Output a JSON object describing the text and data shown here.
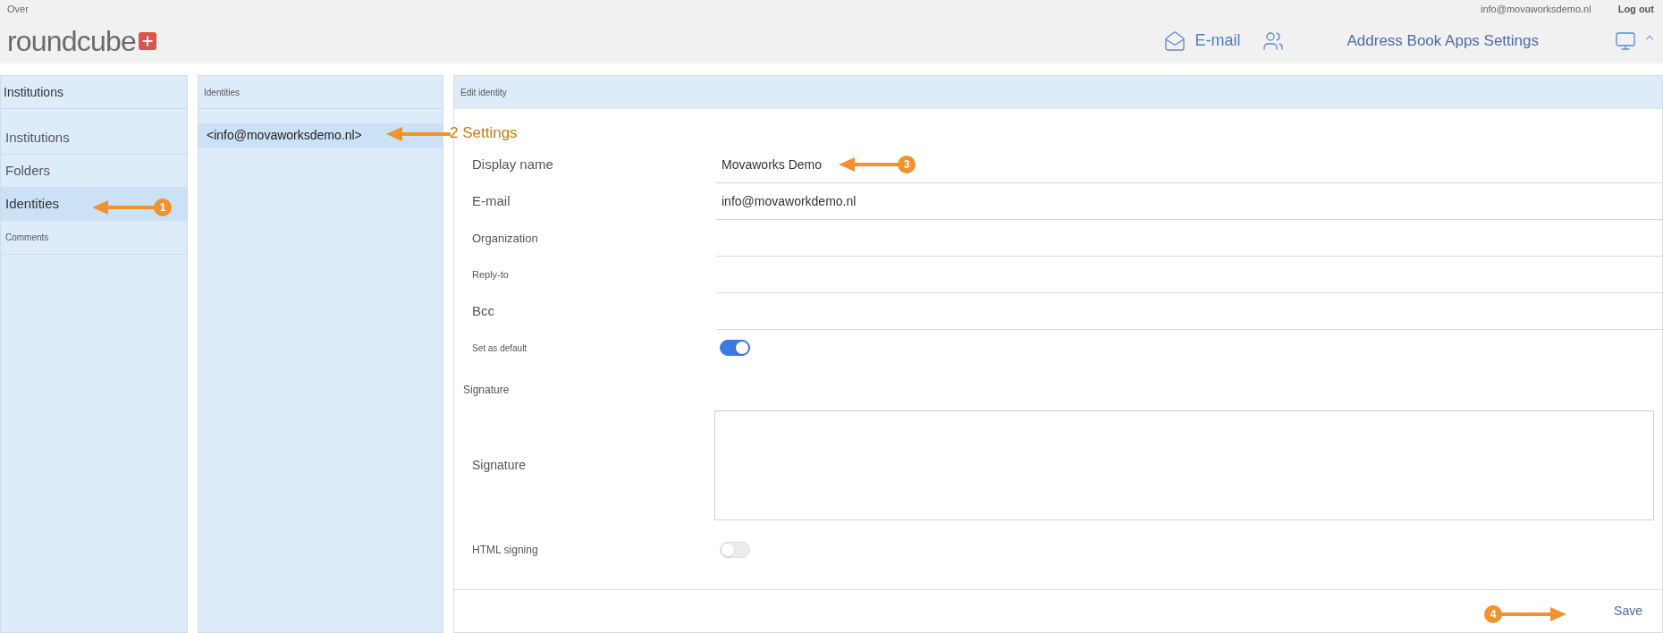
{
  "top_bar": {
    "label": "Over",
    "user_email": "info@movaworksdemo.nl",
    "logout": "Log out"
  },
  "logo": {
    "text": "roundcube"
  },
  "nav": {
    "email": "E-mail",
    "links": "Address Book Apps Settings"
  },
  "sidebar": {
    "title": "Institutions",
    "items": [
      {
        "label": "Institutions",
        "selected": false,
        "kind": "main"
      },
      {
        "label": "Folders",
        "selected": false,
        "kind": "main"
      },
      {
        "label": "Identities",
        "selected": true,
        "kind": "main"
      },
      {
        "label": "Comments",
        "selected": false,
        "kind": "minor"
      }
    ]
  },
  "identities": {
    "title": "Identities",
    "items": [
      {
        "label": "<info@movaworksdemo.nl>",
        "selected": true
      }
    ]
  },
  "form": {
    "title": "Edit identity",
    "fields": [
      {
        "kind": "text",
        "label": "Display name",
        "value": "Movaworks Demo"
      },
      {
        "kind": "text",
        "label": "E-mail",
        "value": "info@movaworkdemo.nl"
      },
      {
        "kind": "text",
        "label": "Organization"
      },
      {
        "kind": "text",
        "label": "Reply-to"
      },
      {
        "kind": "text",
        "label": "Bcc"
      },
      {
        "kind": "toggle",
        "label": "Set as default",
        "on": true
      },
      {
        "kind": "heading",
        "label": "Signature"
      },
      {
        "kind": "textarea",
        "label": "Signature"
      },
      {
        "kind": "toggle",
        "label": "HTML signing",
        "on": false
      }
    ],
    "save": "Save"
  },
  "annotations": [
    {
      "number": "1"
    },
    {
      "label": "2 Settings"
    },
    {
      "number": "3"
    },
    {
      "number": "4"
    }
  ]
}
